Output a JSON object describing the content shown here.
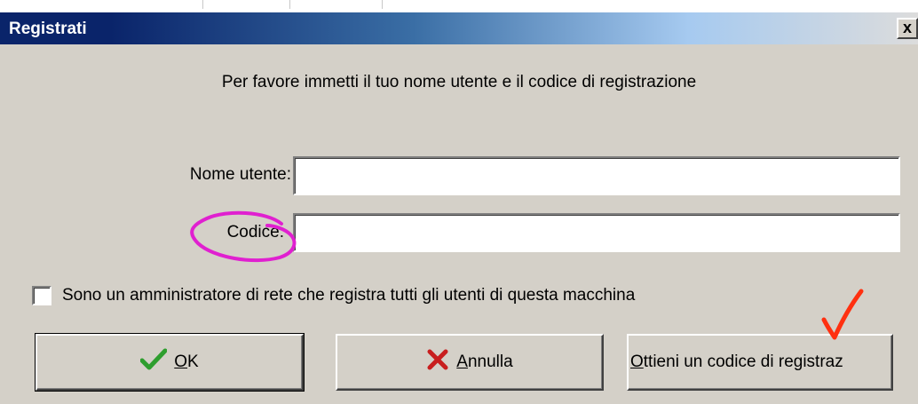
{
  "window": {
    "title": "Registrati",
    "close_label": "x"
  },
  "dialog": {
    "instruction": "Per favore immetti il tuo nome utente e il codice di registrazione",
    "username_label": "Nome utente:",
    "username_value": "",
    "code_label": "Codice:",
    "code_value": "",
    "admin_checkbox_label": "Sono un amministratore di rete che registra tutti gli utenti di questa macchina",
    "admin_checkbox_checked": false
  },
  "buttons": {
    "ok_mnemonic": "O",
    "ok_rest": "K",
    "cancel_mnemonic": "A",
    "cancel_rest": "nnulla",
    "get_code_mnemonic": "O",
    "get_code_rest": "ttieni un codice di registraz"
  },
  "icons": {
    "ok": "check-icon",
    "cancel": "x-icon"
  },
  "colors": {
    "title_bar_start": "#0a246a",
    "title_bar_end": "#dcdcdc",
    "check_green": "#2e9e2e",
    "cancel_red": "#c81e1e",
    "annotation_magenta": "#e020d0",
    "annotation_red": "#ff3010"
  }
}
